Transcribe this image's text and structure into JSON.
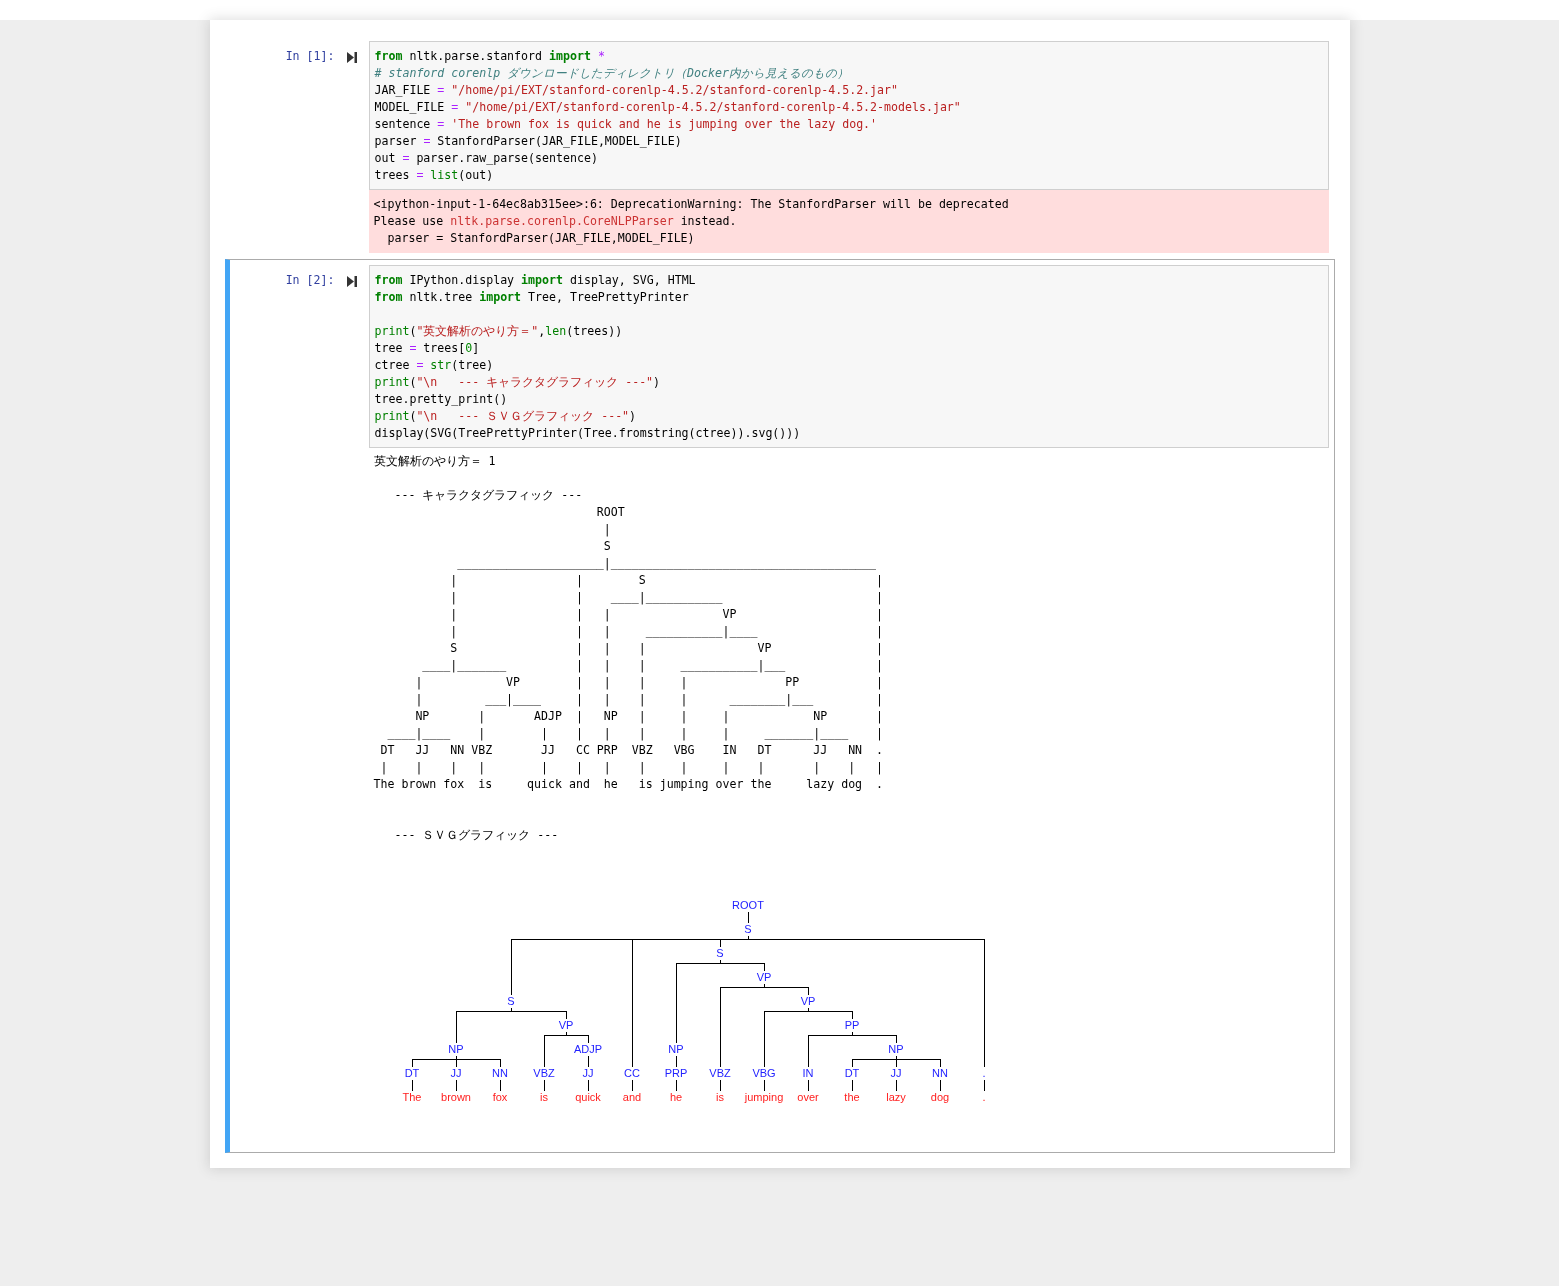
{
  "cells": [
    {
      "prompt": "In [1]:",
      "selected": false,
      "input": [
        {
          "kind": "code",
          "tokens": [
            {
              "text": "from",
              "kind": "keyword"
            },
            {
              "text": " nltk.parse.stanford ",
              "kind": "plain"
            },
            {
              "text": "import ",
              "kind": "keyword"
            },
            {
              "text": "*",
              "kind": "operator"
            }
          ]
        },
        {
          "kind": "code",
          "tokens": [
            {
              "text": "# stanford corenlp ダウンロードしたディレクトリ（Docker内から見えるのもの）",
              "kind": "comment"
            }
          ]
        },
        {
          "kind": "code",
          "tokens": [
            {
              "text": "JAR_FILE ",
              "kind": "plain"
            },
            {
              "text": "= ",
              "kind": "operator"
            },
            {
              "text": "\"/home/pi/EXT/stanford-corenlp-4.5.2/stanford-corenlp-4.5.2.jar\"",
              "kind": "string"
            }
          ]
        },
        {
          "kind": "code",
          "tokens": [
            {
              "text": "MODEL_FILE ",
              "kind": "plain"
            },
            {
              "text": "= ",
              "kind": "operator"
            },
            {
              "text": "\"/home/pi/EXT/stanford-corenlp-4.5.2/stanford-corenlp-4.5.2-models.jar\"",
              "kind": "string"
            }
          ]
        },
        {
          "kind": "code",
          "tokens": [
            {
              "text": "sentence ",
              "kind": "plain"
            },
            {
              "text": "= ",
              "kind": "operator"
            },
            {
              "text": "'The brown fox is quick and he is jumping over the lazy dog.'",
              "kind": "string"
            }
          ]
        },
        {
          "kind": "code",
          "tokens": [
            {
              "text": "parser ",
              "kind": "plain"
            },
            {
              "text": "=",
              "kind": "operator"
            },
            {
              "text": " StanfordParser(JAR_FILE,MODEL_FILE)",
              "kind": "plain"
            }
          ]
        },
        {
          "kind": "code",
          "tokens": [
            {
              "text": "out ",
              "kind": "plain"
            },
            {
              "text": "=",
              "kind": "operator"
            },
            {
              "text": " parser.raw_parse(sentence)",
              "kind": "plain"
            }
          ]
        },
        {
          "kind": "code",
          "tokens": [
            {
              "text": "trees ",
              "kind": "plain"
            },
            {
              "text": "= ",
              "kind": "operator"
            },
            {
              "text": "list",
              "kind": "builtin"
            },
            {
              "text": "(out)",
              "kind": "plain"
            }
          ]
        }
      ],
      "outputs": [
        {
          "kind": "stderr",
          "lines": [
            [
              {
                "text": "<ipython-input-1-64ec8ab315ee>:6: DeprecationWarning: The StanfordParser will be deprecated",
                "kind": "plain"
              }
            ],
            [
              {
                "text": "Please use ",
                "kind": "plain"
              },
              {
                "text": "nltk.parse.corenlp.CoreNLPParser",
                "kind": "highlight"
              },
              {
                "text": " instead.",
                "kind": "plain"
              }
            ],
            [
              {
                "text": "  parser = StanfordParser(JAR_FILE,MODEL_FILE)",
                "kind": "plain"
              }
            ]
          ]
        }
      ]
    },
    {
      "prompt": "In [2]:",
      "selected": true,
      "input": [
        {
          "kind": "code",
          "tokens": [
            {
              "text": "from",
              "kind": "keyword"
            },
            {
              "text": " IPython.display ",
              "kind": "plain"
            },
            {
              "text": "import",
              "kind": "keyword"
            },
            {
              "text": " display, SVG, HTML",
              "kind": "plain"
            }
          ]
        },
        {
          "kind": "code",
          "tokens": [
            {
              "text": "from",
              "kind": "keyword"
            },
            {
              "text": " nltk.tree ",
              "kind": "plain"
            },
            {
              "text": "import",
              "kind": "keyword"
            },
            {
              "text": " Tree, TreePrettyPrinter",
              "kind": "plain"
            }
          ]
        },
        {
          "kind": "blank"
        },
        {
          "kind": "code",
          "tokens": [
            {
              "text": "print",
              "kind": "builtin"
            },
            {
              "text": "(",
              "kind": "plain"
            },
            {
              "text": "\"英文解析のやり方＝\"",
              "kind": "string"
            },
            {
              "text": ",",
              "kind": "plain"
            },
            {
              "text": "len",
              "kind": "builtin"
            },
            {
              "text": "(trees))",
              "kind": "plain"
            }
          ]
        },
        {
          "kind": "code",
          "tokens": [
            {
              "text": "tree ",
              "kind": "plain"
            },
            {
              "text": "=",
              "kind": "operator"
            },
            {
              "text": " trees[",
              "kind": "plain"
            },
            {
              "text": "0",
              "kind": "number"
            },
            {
              "text": "]",
              "kind": "plain"
            }
          ]
        },
        {
          "kind": "code",
          "tokens": [
            {
              "text": "ctree ",
              "kind": "plain"
            },
            {
              "text": "= ",
              "kind": "operator"
            },
            {
              "text": "str",
              "kind": "builtin"
            },
            {
              "text": "(tree)",
              "kind": "plain"
            }
          ]
        },
        {
          "kind": "code",
          "tokens": [
            {
              "text": "print",
              "kind": "builtin"
            },
            {
              "text": "(",
              "kind": "plain"
            },
            {
              "text": "\"\\n   --- キャラクタグラフィック ---\"",
              "kind": "string"
            },
            {
              "text": ")",
              "kind": "plain"
            }
          ]
        },
        {
          "kind": "code",
          "tokens": [
            {
              "text": "tree.pretty_print()",
              "kind": "plain"
            }
          ]
        },
        {
          "kind": "code",
          "tokens": [
            {
              "text": "print",
              "kind": "builtin"
            },
            {
              "text": "(",
              "kind": "plain"
            },
            {
              "text": "\"\\n   --- ＳＶＧグラフィック ---\"",
              "kind": "string"
            },
            {
              "text": ")",
              "kind": "plain"
            }
          ]
        },
        {
          "kind": "code",
          "tokens": [
            {
              "text": "display(SVG(TreePrettyPrinter(Tree.fromstring(ctree)).svg()))",
              "kind": "plain"
            }
          ]
        }
      ],
      "outputs": [
        {
          "kind": "stdout",
          "text": "英文解析のやり方＝ 1"
        },
        {
          "kind": "stdout",
          "text": "   --- キャラクタグラフィック ---"
        },
        {
          "kind": "ascii_tree",
          "lines": [
            "                                ROOT",
            "                                 |",
            "                                 S",
            "            _____________________|______________________________________",
            "           |                 |        S                                 |",
            "           |                 |    ____|___________                      |",
            "           |                 |   |                VP                    |",
            "           |                 |   |     ___________|____                 |",
            "           S                 |   |    |                VP               |",
            "       ____|_______          |   |    |     ___________|___             |",
            "      |            VP        |   |    |     |              PP           |",
            "      |         ___|____     |   |    |     |      ________|___         |",
            "      NP       |       ADJP  |   NP   |     |     |            NP       |",
            "  ____|____    |        |    |   |    |     |     |     _______|____    |",
            " DT   JJ   NN VBZ       JJ   CC PRP  VBZ   VBG    IN   DT      JJ   NN  .",
            " |    |    |   |        |    |   |    |     |     |    |       |    |   |",
            "The brown fox  is     quick and  he   is jumping over the     lazy dog  ."
          ]
        },
        {
          "kind": "stdout",
          "text": "   --- ＳＶＧグラフィック ---"
        },
        {
          "kind": "svg_tree",
          "tree": {
            "label": "ROOT",
            "children": [
              {
                "label": "S",
                "children": [
                  {
                    "label": "S",
                    "children": [
                      {
                        "label": "NP",
                        "children": [
                          {
                            "label": "DT",
                            "children": [
                              {
                                "label": "The"
                              }
                            ]
                          },
                          {
                            "label": "JJ",
                            "children": [
                              {
                                "label": "brown"
                              }
                            ]
                          },
                          {
                            "label": "NN",
                            "children": [
                              {
                                "label": "fox"
                              }
                            ]
                          }
                        ]
                      },
                      {
                        "label": "VP",
                        "children": [
                          {
                            "label": "VBZ",
                            "children": [
                              {
                                "label": "is"
                              }
                            ]
                          },
                          {
                            "label": "ADJP",
                            "children": [
                              {
                                "label": "JJ",
                                "children": [
                                  {
                                    "label": "quick"
                                  }
                                ]
                              }
                            ]
                          }
                        ]
                      }
                    ]
                  },
                  {
                    "label": "CC",
                    "children": [
                      {
                        "label": "and"
                      }
                    ]
                  },
                  {
                    "label": "S",
                    "children": [
                      {
                        "label": "NP",
                        "children": [
                          {
                            "label": "PRP",
                            "children": [
                              {
                                "label": "he"
                              }
                            ]
                          }
                        ]
                      },
                      {
                        "label": "VP",
                        "children": [
                          {
                            "label": "VBZ",
                            "children": [
                              {
                                "label": "is"
                              }
                            ]
                          },
                          {
                            "label": "VP",
                            "children": [
                              {
                                "label": "VBG",
                                "children": [
                                  {
                                    "label": "jumping"
                                  }
                                ]
                              },
                              {
                                "label": "PP",
                                "children": [
                                  {
                                    "label": "IN",
                                    "children": [
                                      {
                                        "label": "over"
                                      }
                                    ]
                                  },
                                  {
                                    "label": "NP",
                                    "children": [
                                      {
                                        "label": "DT",
                                        "children": [
                                          {
                                            "label": "the"
                                          }
                                        ]
                                      },
                                      {
                                        "label": "JJ",
                                        "children": [
                                          {
                                            "label": "lazy"
                                          }
                                        ]
                                      },
                                      {
                                        "label": "NN",
                                        "children": [
                                          {
                                            "label": "dog"
                                          }
                                        ]
                                      }
                                    ]
                                  }
                                ]
                              }
                            ]
                          }
                        ]
                      }
                    ]
                  },
                  {
                    "label": ".",
                    "children": [
                      {
                        "label": "."
                      }
                    ]
                  }
                ]
              }
            ]
          }
        }
      ]
    }
  ]
}
